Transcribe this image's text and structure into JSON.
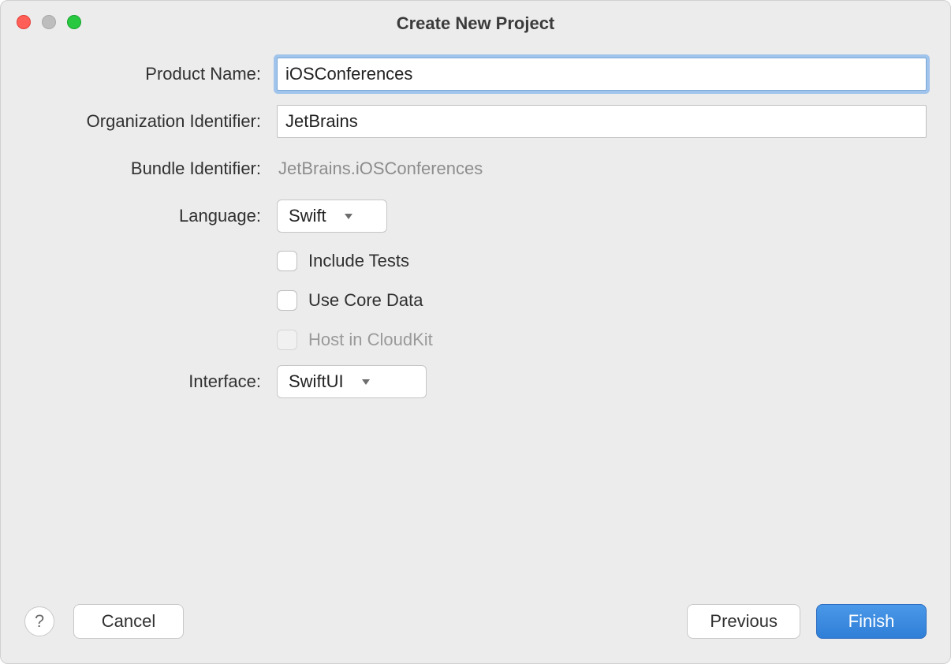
{
  "window": {
    "title": "Create New Project"
  },
  "form": {
    "product_name": {
      "label": "Product Name:",
      "value": "iOSConferences"
    },
    "org_identifier": {
      "label": "Organization Identifier:",
      "value": "JetBrains"
    },
    "bundle_identifier": {
      "label": "Bundle Identifier:",
      "value": "JetBrains.iOSConferences"
    },
    "language": {
      "label": "Language:",
      "value": "Swift"
    },
    "include_tests": {
      "label": "Include Tests",
      "checked": false
    },
    "use_core_data": {
      "label": "Use Core Data",
      "checked": false
    },
    "host_cloudkit": {
      "label": "Host in CloudKit",
      "checked": false,
      "disabled": true
    },
    "interface": {
      "label": "Interface:",
      "value": "SwiftUI"
    }
  },
  "footer": {
    "help": "?",
    "cancel": "Cancel",
    "previous": "Previous",
    "finish": "Finish"
  }
}
